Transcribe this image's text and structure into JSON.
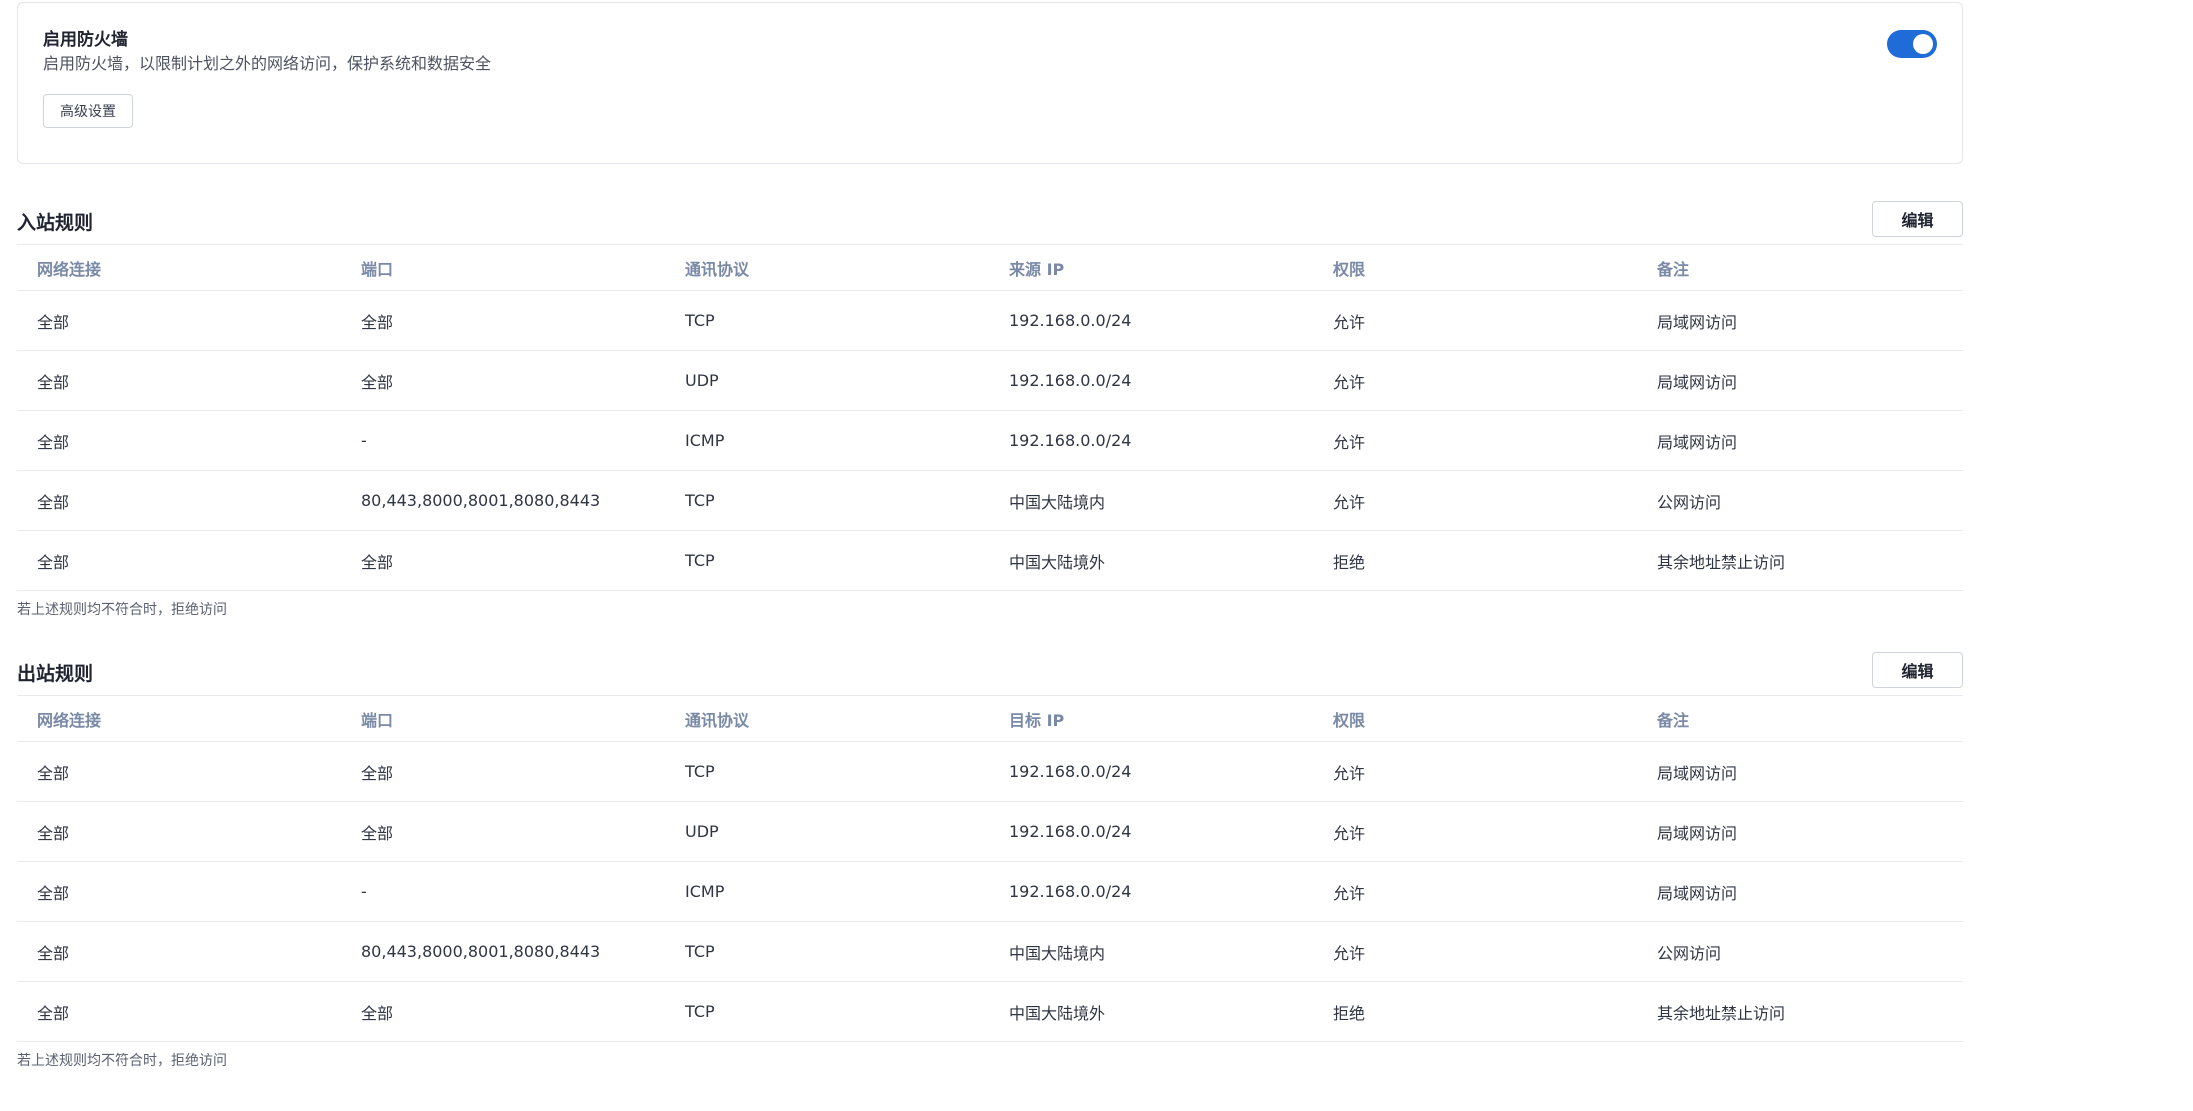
{
  "firewall": {
    "title": "启用防火墙",
    "description": "启用防火墙，以限制计划之外的网络访问，保护系统和数据安全",
    "advanced_button": "高级设置",
    "enabled": true,
    "accent_color": "#1f6bd8"
  },
  "inbound": {
    "title": "入站规则",
    "edit_button": "编辑",
    "columns": [
      "网络连接",
      "端口",
      "通讯协议",
      "来源 IP",
      "权限",
      "备注"
    ],
    "rows": [
      [
        "全部",
        "全部",
        "TCP",
        "192.168.0.0/24",
        "允许",
        "局域网访问"
      ],
      [
        "全部",
        "全部",
        "UDP",
        "192.168.0.0/24",
        "允许",
        "局域网访问"
      ],
      [
        "全部",
        "-",
        "ICMP",
        "192.168.0.0/24",
        "允许",
        "局域网访问"
      ],
      [
        "全部",
        "80,443,8000,8001,8080,8443",
        "TCP",
        "中国大陆境内",
        "允许",
        "公网访问"
      ],
      [
        "全部",
        "全部",
        "TCP",
        "中国大陆境外",
        "拒绝",
        "其余地址禁止访问"
      ]
    ],
    "footnote": "若上述规则均不符合时，拒绝访问"
  },
  "outbound": {
    "title": "出站规则",
    "edit_button": "编辑",
    "columns": [
      "网络连接",
      "端口",
      "通讯协议",
      "目标 IP",
      "权限",
      "备注"
    ],
    "rows": [
      [
        "全部",
        "全部",
        "TCP",
        "192.168.0.0/24",
        "允许",
        "局域网访问"
      ],
      [
        "全部",
        "全部",
        "UDP",
        "192.168.0.0/24",
        "允许",
        "局域网访问"
      ],
      [
        "全部",
        "-",
        "ICMP",
        "192.168.0.0/24",
        "允许",
        "局域网访问"
      ],
      [
        "全部",
        "80,443,8000,8001,8080,8443",
        "TCP",
        "中国大陆境内",
        "允许",
        "公网访问"
      ],
      [
        "全部",
        "全部",
        "TCP",
        "中国大陆境外",
        "拒绝",
        "其余地址禁止访问"
      ]
    ],
    "footnote": "若上述规则均不符合时，拒绝访问"
  }
}
